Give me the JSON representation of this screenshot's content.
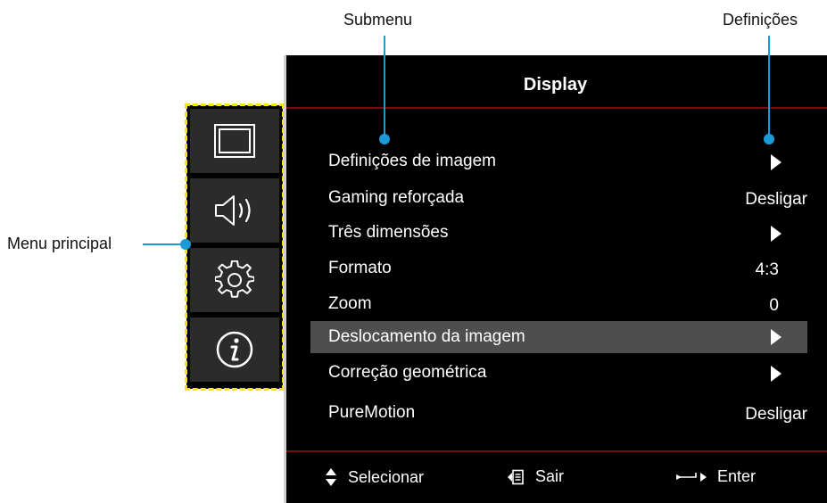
{
  "callouts": {
    "submenu": "Submenu",
    "settings": "Definições",
    "main_menu": "Menu principal"
  },
  "main_menu": {
    "items": [
      {
        "icon": "display-icon"
      },
      {
        "icon": "audio-icon"
      },
      {
        "icon": "gear-icon"
      },
      {
        "icon": "info-icon"
      }
    ]
  },
  "panel": {
    "title": "Display",
    "items": [
      {
        "label": "Definições de imagem",
        "value": "",
        "submenu": true
      },
      {
        "label": "Gaming reforçada",
        "value": "Desligar",
        "submenu": false
      },
      {
        "label": "Três dimensões",
        "value": "",
        "submenu": true
      },
      {
        "label": "Formato",
        "value": "4:3",
        "submenu": false
      },
      {
        "label": "Zoom",
        "value": "0",
        "submenu": false
      },
      {
        "label": "Deslocamento da imagem",
        "value": "",
        "submenu": true,
        "selected": true
      },
      {
        "label": "Correção geométrica",
        "value": "",
        "submenu": true
      },
      {
        "label": "PureMotion",
        "value": "Desligar",
        "submenu": false
      }
    ]
  },
  "footer": {
    "select": "Selecionar",
    "exit": "Sair",
    "enter": "Enter"
  },
  "colors": {
    "callout_line": "#1a9bd7",
    "highlight": "#f4e600",
    "selected_row": "#4e4e4e",
    "divider": "#7a0d0d"
  }
}
